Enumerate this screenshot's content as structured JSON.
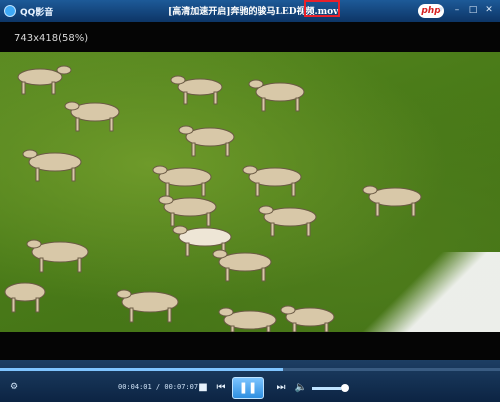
{
  "window": {
    "app_name": "QQ影音",
    "title": "[高清加速开启]奔驰的骏马LED视频.mov",
    "badge": "php"
  },
  "video": {
    "resolution": "743x418(58%)"
  },
  "playback": {
    "time": "00:04:01 / 00:07:07",
    "progress": 0.565,
    "volume": 0.85
  },
  "icons": {
    "minimize": "minimize-icon",
    "maximize": "maximize-icon",
    "close": "close-icon",
    "stop": "stop-icon",
    "prev": "previous-icon",
    "play_pause": "pause-icon",
    "next": "next-icon",
    "volume": "volume-icon"
  },
  "colors": {
    "titlebar": "#0d3566",
    "accent": "#2f8fe0",
    "highlight": "#e8202a"
  }
}
